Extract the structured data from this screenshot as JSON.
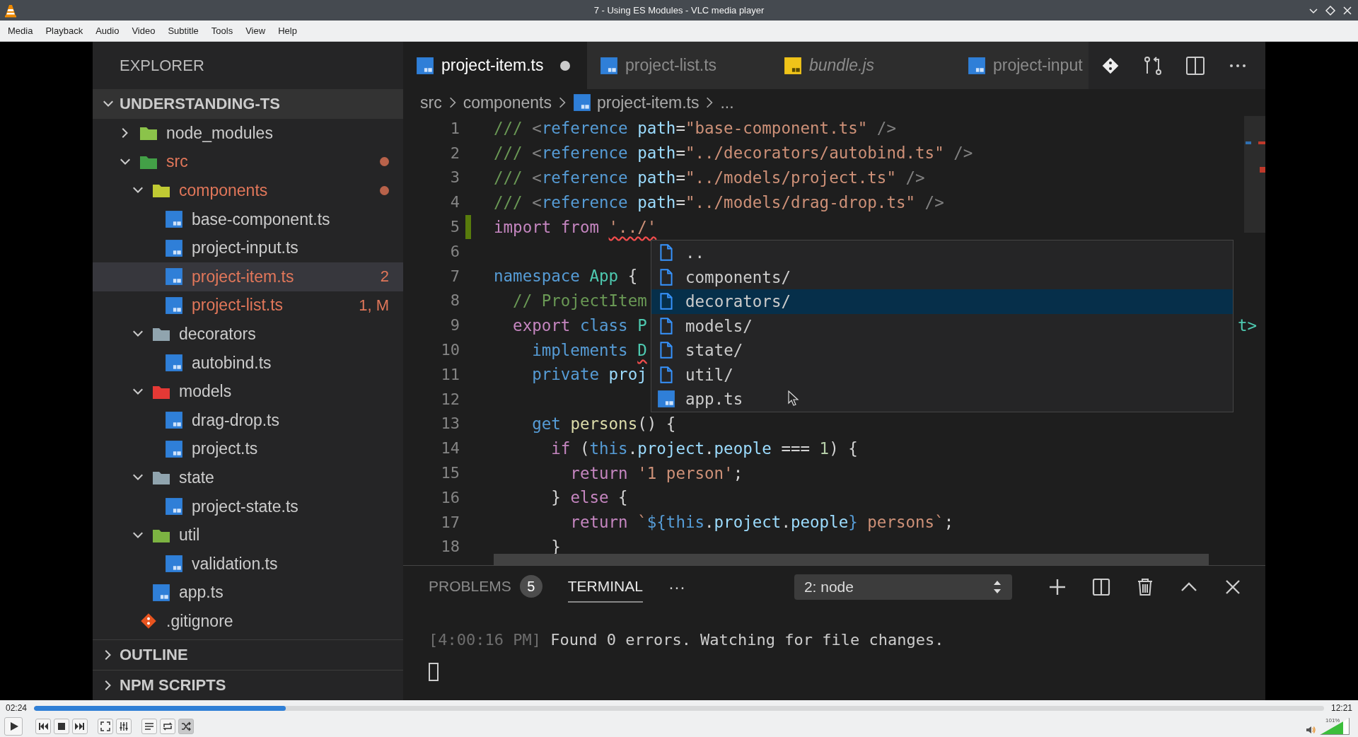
{
  "window": {
    "title": "7 - Using ES Modules - VLC media player"
  },
  "menu": [
    "Media",
    "Playback",
    "Audio",
    "Video",
    "Subtitle",
    "Tools",
    "View",
    "Help"
  ],
  "video": {
    "sidebar": {
      "title": "EXPLORER",
      "section": {
        "title": "UNDERSTANDING-TS",
        "expanded": true
      },
      "tree": [
        {
          "label": "node_modules",
          "kind": "folder",
          "color": "#8bc34a",
          "expanded": false,
          "modified": false,
          "dot": false,
          "selected": false
        },
        {
          "label": "src",
          "kind": "folder",
          "color": "#43a047",
          "expanded": true,
          "modified": true,
          "dot": true,
          "selected": false,
          "children": [
            {
              "label": "components",
              "kind": "folder",
              "color": "#c0ca33",
              "expanded": true,
              "modified": true,
              "dot": true,
              "selected": false,
              "children": [
                {
                  "label": "base-component.ts",
                  "kind": "ts",
                  "modified": false,
                  "dot": false,
                  "selected": false
                },
                {
                  "label": "project-input.ts",
                  "kind": "ts",
                  "modified": false,
                  "dot": false,
                  "selected": false
                },
                {
                  "label": "project-item.ts",
                  "kind": "ts",
                  "modified": true,
                  "dot": false,
                  "selected": true,
                  "badge": "2"
                },
                {
                  "label": "project-list.ts",
                  "kind": "ts",
                  "modified": true,
                  "dot": false,
                  "selected": false,
                  "badge": "1, M"
                }
              ]
            },
            {
              "label": "decorators",
              "kind": "folder",
              "color": "#90a4ae",
              "expanded": true,
              "modified": false,
              "dot": false,
              "selected": false,
              "children": [
                {
                  "label": "autobind.ts",
                  "kind": "ts",
                  "modified": false,
                  "dot": false,
                  "selected": false
                }
              ]
            },
            {
              "label": "models",
              "kind": "folder",
              "color": "#e53935",
              "expanded": true,
              "modified": false,
              "dot": false,
              "selected": false,
              "children": [
                {
                  "label": "drag-drop.ts",
                  "kind": "ts",
                  "modified": false,
                  "dot": false,
                  "selected": false
                },
                {
                  "label": "project.ts",
                  "kind": "ts",
                  "modified": false,
                  "dot": false,
                  "selected": false
                }
              ]
            },
            {
              "label": "state",
              "kind": "folder",
              "color": "#90a4ae",
              "expanded": true,
              "modified": false,
              "dot": false,
              "selected": false,
              "children": [
                {
                  "label": "project-state.ts",
                  "kind": "ts",
                  "modified": false,
                  "dot": false,
                  "selected": false
                }
              ]
            },
            {
              "label": "util",
              "kind": "folder",
              "color": "#7cb342",
              "expanded": true,
              "modified": false,
              "dot": false,
              "selected": false,
              "children": [
                {
                  "label": "validation.ts",
                  "kind": "ts",
                  "modified": false,
                  "dot": false,
                  "selected": false
                }
              ]
            },
            {
              "label": "app.ts",
              "kind": "ts",
              "modified": false,
              "dot": false,
              "selected": false
            }
          ]
        },
        {
          "label": ".gitignore",
          "kind": "git",
          "modified": false,
          "dot": false,
          "selected": false
        }
      ],
      "panels": [
        {
          "title": "OUTLINE",
          "expanded": false
        },
        {
          "title": "NPM SCRIPTS",
          "expanded": false
        }
      ]
    },
    "tabs": [
      {
        "label": "project-item.ts",
        "kind": "ts",
        "selected": true,
        "dirty": true,
        "preview": false
      },
      {
        "label": "project-list.ts",
        "kind": "ts",
        "selected": false,
        "dirty": false,
        "preview": false
      },
      {
        "label": "bundle.js",
        "kind": "js",
        "selected": false,
        "dirty": false,
        "preview": true
      },
      {
        "label": "project-input",
        "kind": "ts",
        "selected": false,
        "dirty": false,
        "preview": false
      }
    ],
    "breadcrumb": [
      {
        "label": "src",
        "kind": "folder"
      },
      {
        "label": "components",
        "kind": "folder"
      },
      {
        "label": "project-item.ts",
        "kind": "ts"
      },
      {
        "label": "...",
        "kind": "more"
      }
    ],
    "code": [
      {
        "number": "1",
        "changed": false,
        "tokens": [
          {
            "t": "/// ",
            "kind": "comment"
          },
          {
            "t": "<",
            "kind": "punct"
          },
          {
            "t": "reference",
            "kind": "tag"
          },
          {
            "t": " path",
            "kind": "attr"
          },
          {
            "t": "=",
            "kind": "plain"
          },
          {
            "t": "\"base-component.ts\"",
            "kind": "string"
          },
          {
            "t": " />",
            "kind": "punct"
          }
        ]
      },
      {
        "number": "2",
        "changed": false,
        "tokens": [
          {
            "t": "/// ",
            "kind": "comment"
          },
          {
            "t": "<",
            "kind": "punct"
          },
          {
            "t": "reference",
            "kind": "tag"
          },
          {
            "t": " path",
            "kind": "attr"
          },
          {
            "t": "=",
            "kind": "plain"
          },
          {
            "t": "\"../decorators/autobind.ts\"",
            "kind": "string"
          },
          {
            "t": " />",
            "kind": "punct"
          }
        ]
      },
      {
        "number": "3",
        "changed": false,
        "tokens": [
          {
            "t": "/// ",
            "kind": "comment"
          },
          {
            "t": "<",
            "kind": "punct"
          },
          {
            "t": "reference",
            "kind": "tag"
          },
          {
            "t": " path",
            "kind": "attr"
          },
          {
            "t": "=",
            "kind": "plain"
          },
          {
            "t": "\"../models/project.ts\"",
            "kind": "string"
          },
          {
            "t": " />",
            "kind": "punct"
          }
        ]
      },
      {
        "number": "4",
        "changed": false,
        "tokens": [
          {
            "t": "/// ",
            "kind": "comment"
          },
          {
            "t": "<",
            "kind": "punct"
          },
          {
            "t": "reference",
            "kind": "tag"
          },
          {
            "t": " path",
            "kind": "attr"
          },
          {
            "t": "=",
            "kind": "plain"
          },
          {
            "t": "\"../models/drag-drop.ts\"",
            "kind": "string"
          },
          {
            "t": " />",
            "kind": "punct"
          }
        ]
      },
      {
        "number": "5",
        "changed": true,
        "tokens": [
          {
            "t": "import ",
            "kind": "control",
            "error": false
          },
          {
            "t": "from ",
            "kind": "control",
            "error": false
          },
          {
            "t": "'../'",
            "kind": "string",
            "error": true
          }
        ]
      },
      {
        "number": "6",
        "changed": false
      },
      {
        "number": "7",
        "changed": false,
        "tokens": [
          {
            "t": "namespace ",
            "kind": "storage"
          },
          {
            "t": "App",
            "kind": "type"
          },
          {
            "t": " {",
            "kind": "plain"
          }
        ]
      },
      {
        "number": "8",
        "changed": false,
        "tokens": [
          {
            "t": "  // ProjectItem",
            "kind": "comment"
          }
        ]
      },
      {
        "number": "9",
        "changed": false,
        "tokens": [
          {
            "t": "  export ",
            "kind": "control"
          },
          {
            "t": "class ",
            "kind": "storage"
          },
          {
            "t": "P",
            "kind": "type"
          }
        ],
        "tail": "t>"
      },
      {
        "number": "10",
        "changed": false,
        "tokens": [
          {
            "t": "    implements ",
            "kind": "storage",
            "error": false
          },
          {
            "t": "D",
            "kind": "type",
            "error": true
          }
        ]
      },
      {
        "number": "11",
        "changed": false,
        "tokens": [
          {
            "t": "    private ",
            "kind": "storage"
          },
          {
            "t": "proj",
            "kind": "var"
          }
        ]
      },
      {
        "number": "12",
        "changed": false
      },
      {
        "number": "13",
        "changed": false,
        "tokens": [
          {
            "t": "    get ",
            "kind": "storage"
          },
          {
            "t": "persons",
            "kind": "fn"
          },
          {
            "t": "() {",
            "kind": "plain"
          }
        ]
      },
      {
        "number": "14",
        "changed": false,
        "tokens": [
          {
            "t": "      if",
            "kind": "control"
          },
          {
            "t": " (",
            "kind": "plain"
          },
          {
            "t": "this",
            "kind": "storage"
          },
          {
            "t": ".",
            "kind": "plain"
          },
          {
            "t": "project",
            "kind": "var"
          },
          {
            "t": ".",
            "kind": "plain"
          },
          {
            "t": "people",
            "kind": "var"
          },
          {
            "t": " === ",
            "kind": "plain"
          },
          {
            "t": "1",
            "kind": "number"
          },
          {
            "t": ") {",
            "kind": "plain"
          }
        ]
      },
      {
        "number": "15",
        "changed": false,
        "tokens": [
          {
            "t": "        return ",
            "kind": "control"
          },
          {
            "t": "'1 person'",
            "kind": "string"
          },
          {
            "t": ";",
            "kind": "plain"
          }
        ]
      },
      {
        "number": "16",
        "changed": false,
        "tokens": [
          {
            "t": "      } ",
            "kind": "plain"
          },
          {
            "t": "else",
            "kind": "control"
          },
          {
            "t": " {",
            "kind": "plain"
          }
        ]
      },
      {
        "number": "17",
        "changed": false,
        "tokens": [
          {
            "t": "        return",
            "kind": "control"
          },
          {
            "t": " `",
            "kind": "string"
          },
          {
            "t": "${",
            "kind": "storage"
          },
          {
            "t": "this",
            "kind": "storage"
          },
          {
            "t": ".",
            "kind": "plain"
          },
          {
            "t": "project",
            "kind": "var"
          },
          {
            "t": ".",
            "kind": "plain"
          },
          {
            "t": "people",
            "kind": "var"
          },
          {
            "t": "}",
            "kind": "storage"
          },
          {
            "t": " persons`",
            "kind": "string"
          },
          {
            "t": ";",
            "kind": "plain"
          }
        ]
      },
      {
        "number": "18",
        "changed": false,
        "tokens": [
          {
            "t": "      }",
            "kind": "plain"
          }
        ]
      }
    ],
    "suggestions": [
      {
        "label": "..",
        "kind": "file",
        "selected": false
      },
      {
        "label": "components/",
        "kind": "file",
        "selected": false
      },
      {
        "label": "decorators/",
        "kind": "file",
        "selected": true
      },
      {
        "label": "models/",
        "kind": "file",
        "selected": false
      },
      {
        "label": "state/",
        "kind": "file",
        "selected": false
      },
      {
        "label": "util/",
        "kind": "file",
        "selected": false
      },
      {
        "label": "app.ts",
        "kind": "ts",
        "selected": false
      }
    ],
    "panel": {
      "tabs": [
        {
          "label": "PROBLEMS",
          "count": "5",
          "selected": false
        },
        {
          "label": "TERMINAL",
          "selected": true
        }
      ],
      "more": "···",
      "terminal_select": "2: node",
      "terminal_lines": [
        {
          "time": "[4:00:16 PM]",
          "text": " Found 0 errors. Watching for file changes."
        }
      ]
    }
  },
  "player": {
    "elapsed": "02:24",
    "total": "12:21",
    "position": {
      "level": 0.195
    },
    "controls": [
      {
        "kind": "play"
      },
      {
        "kind": "previous"
      },
      {
        "kind": "stop"
      },
      {
        "kind": "next"
      },
      {
        "kind": "fullscreen"
      },
      {
        "kind": "extended"
      },
      {
        "kind": "playlist"
      },
      {
        "kind": "loop",
        "on": false
      },
      {
        "kind": "shuffle",
        "on": true
      }
    ],
    "volume": {
      "reading": "101%",
      "level": 0.81
    }
  }
}
